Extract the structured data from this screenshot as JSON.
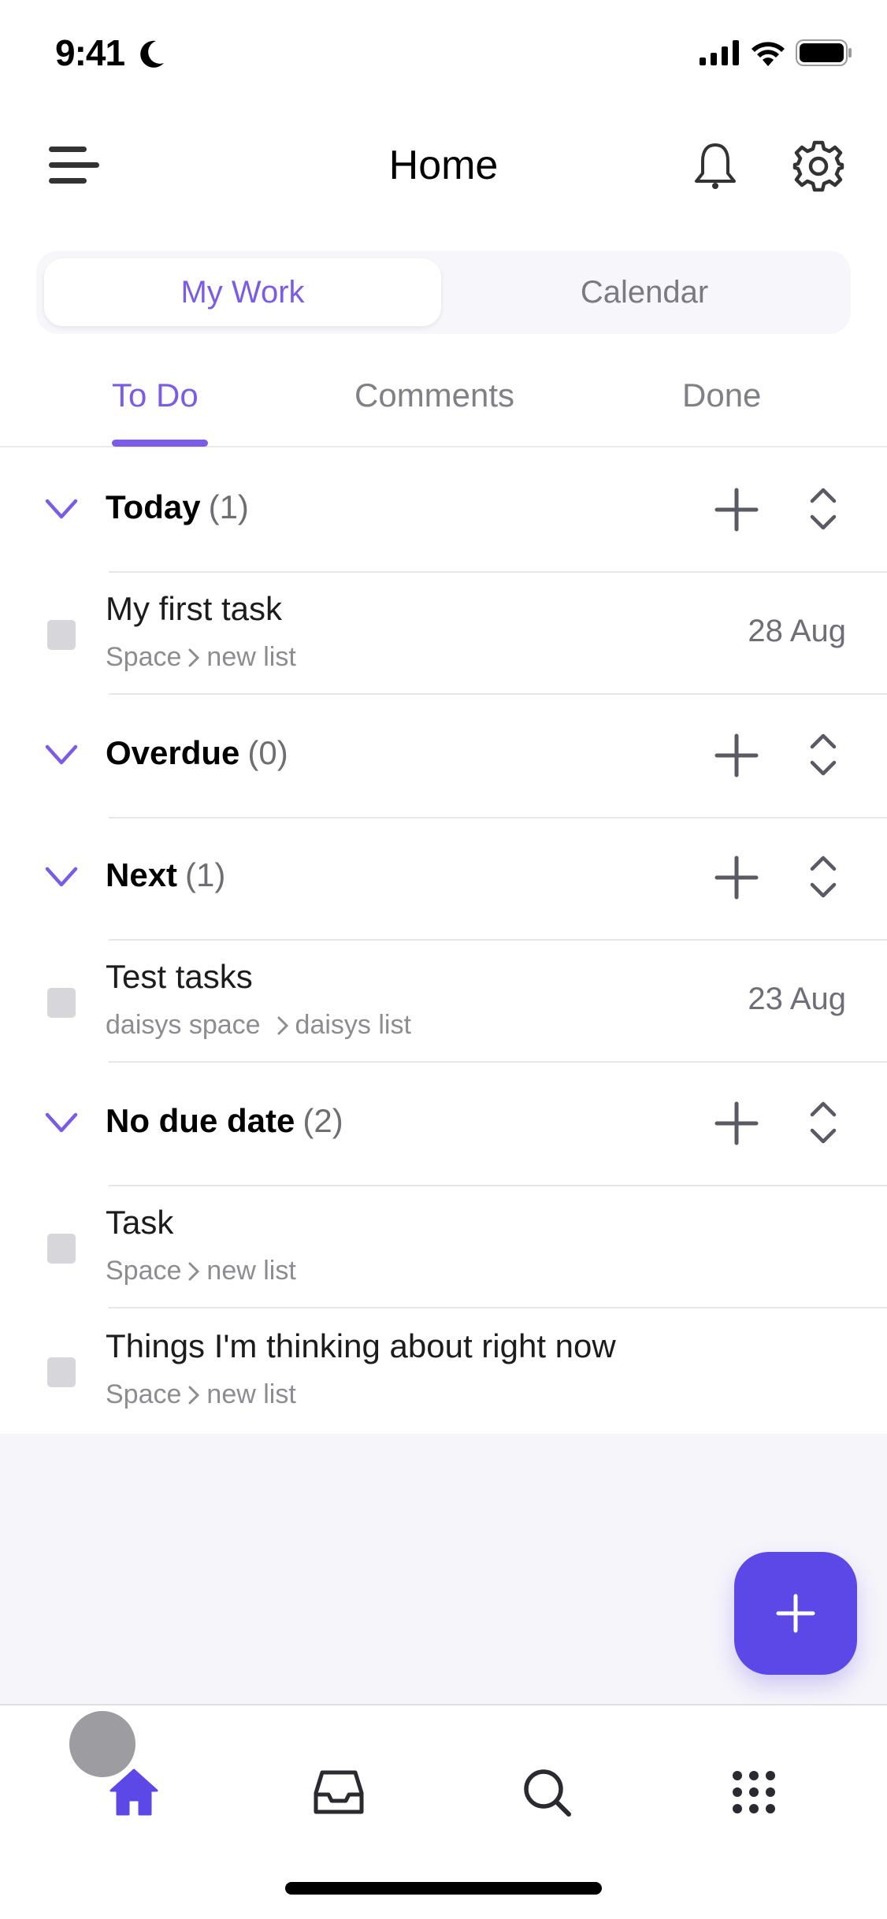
{
  "status_bar": {
    "time": "9:41",
    "focus_icon": "moon-icon",
    "signal_icon": "cellular-signal-icon",
    "wifi_icon": "wifi-icon",
    "battery_icon": "battery-icon"
  },
  "header": {
    "title": "Home",
    "menu_icon": "hamburger-menu-icon",
    "notifications_icon": "bell-icon",
    "settings_icon": "gear-icon"
  },
  "segmented_control": {
    "options": [
      "My Work",
      "Calendar"
    ],
    "selected": "My Work"
  },
  "tabs": {
    "items": [
      "To Do",
      "Comments",
      "Done"
    ],
    "active": "To Do"
  },
  "sections": [
    {
      "title": "Today",
      "count": "(1)",
      "tasks": [
        {
          "title": "My first task",
          "space": "Space",
          "list": "new list",
          "date": "28 Aug"
        }
      ]
    },
    {
      "title": "Overdue",
      "count": "(0)",
      "tasks": []
    },
    {
      "title": "Next",
      "count": "(1)",
      "tasks": [
        {
          "title": "Test tasks",
          "space": "daisys space",
          "list": "daisys list",
          "date": "23 Aug"
        }
      ]
    },
    {
      "title": "No due date",
      "count": "(2)",
      "tasks": [
        {
          "title": "Task",
          "space": "Space",
          "list": "new list",
          "date": ""
        },
        {
          "title": "Things I'm thinking about right now",
          "space": "Space",
          "list": "new list",
          "date": ""
        }
      ]
    }
  ],
  "fab": {
    "icon": "plus-icon"
  },
  "tabbar": {
    "items": [
      {
        "name": "home",
        "icon": "home-icon",
        "active": true
      },
      {
        "name": "inbox",
        "icon": "inbox-icon",
        "active": false
      },
      {
        "name": "search",
        "icon": "search-icon",
        "active": false
      },
      {
        "name": "more",
        "icon": "grid-dots-icon",
        "active": false
      }
    ]
  },
  "colors": {
    "accent": "#7b5ce6",
    "fab": "#5c48e6",
    "text": "#1c1c1e",
    "muted": "#8c8c92",
    "background_empty": "#f6f5fa"
  }
}
